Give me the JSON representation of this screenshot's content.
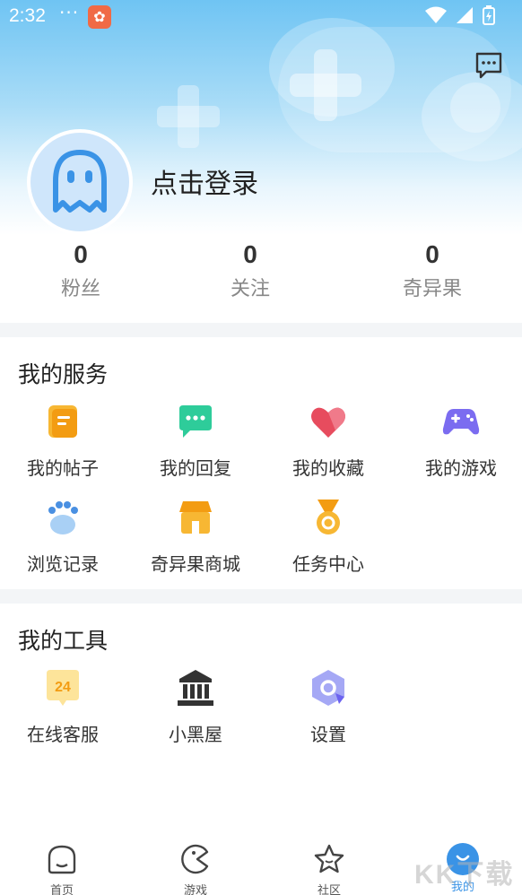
{
  "status_bar": {
    "time": "2:32",
    "dots": "···"
  },
  "profile": {
    "login_text": "点击登录"
  },
  "stats": [
    {
      "value": "0",
      "label": "粉丝"
    },
    {
      "value": "0",
      "label": "关注"
    },
    {
      "value": "0",
      "label": "奇异果"
    }
  ],
  "services": {
    "title": "我的服务",
    "items": [
      {
        "label": "我的帖子",
        "icon": "posts-icon"
      },
      {
        "label": "我的回复",
        "icon": "reply-icon"
      },
      {
        "label": "我的收藏",
        "icon": "heart-icon"
      },
      {
        "label": "我的游戏",
        "icon": "gamepad-icon"
      },
      {
        "label": "浏览记录",
        "icon": "paw-icon"
      },
      {
        "label": "奇异果商城",
        "icon": "store-icon"
      },
      {
        "label": "任务中心",
        "icon": "medal-icon"
      }
    ]
  },
  "tools": {
    "title": "我的工具",
    "items": [
      {
        "label": "在线客服",
        "icon": "support-24-icon",
        "badge": "24"
      },
      {
        "label": "小黑屋",
        "icon": "bank-building-icon"
      },
      {
        "label": "设置",
        "icon": "settings-hex-icon"
      }
    ]
  },
  "bottom_nav": [
    {
      "label": "首页",
      "icon": "home-icon"
    },
    {
      "label": "游戏",
      "icon": "game-pacman-icon"
    },
    {
      "label": "社区",
      "icon": "star-community-icon"
    },
    {
      "label": "我的",
      "icon": "me-icon",
      "active": true
    }
  ],
  "watermark": "KK下载",
  "colors": {
    "accent": "#3a93e6",
    "header_top": "#6fc4f3"
  }
}
